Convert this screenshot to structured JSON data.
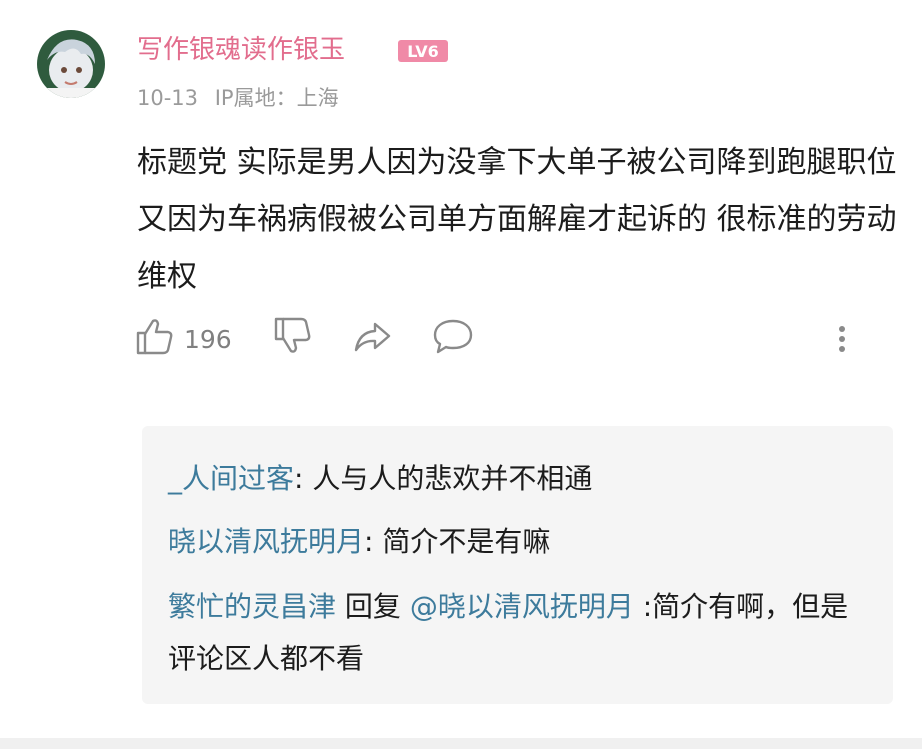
{
  "comment": {
    "username": "写作银魂读作银玉",
    "level_badge": "LV6",
    "date": "10-13",
    "location": "IP属地：上海",
    "text": "标题党 实际是男人因为没拿下大单子被公司降到跑腿职位 又因为车祸病假被公司单方面解雇才起诉的 很标准的劳动维权",
    "like_count": "196"
  },
  "icons": {
    "like": "thumbs-up-icon",
    "dislike": "thumbs-down-icon",
    "share": "share-icon",
    "reply": "comment-bubble-icon",
    "more": "more-vertical-icon"
  },
  "replies": [
    {
      "name": "_人间过客",
      "sep": ":",
      "text": " 人与人的悲欢并不相通"
    },
    {
      "name": "晓以清风抚明月",
      "sep": ":",
      "text": " 简介不是有嘛"
    },
    {
      "name": "繁忙的灵昌津",
      "mid": " 回复 ",
      "mention": "@晓以清风抚明月",
      "text": " :简介有啊，但是评论区人都不看"
    }
  ],
  "colors": {
    "username": "#e26d8d",
    "badge": "#f08aa7",
    "reply_name": "#3d7b9c",
    "meta": "#9a9a9a",
    "reply_bg": "#f5f5f5"
  }
}
